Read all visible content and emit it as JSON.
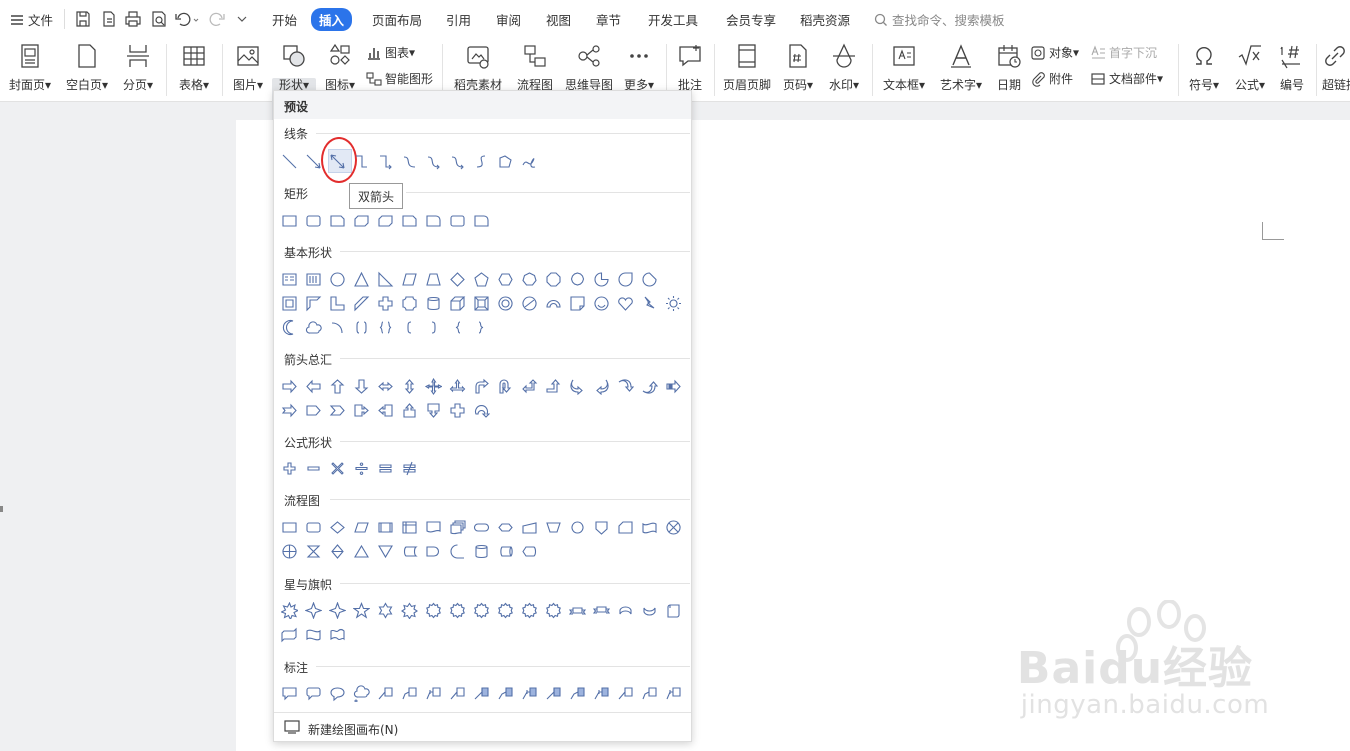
{
  "menubar": {
    "file": "文件",
    "tabs": [
      "开始",
      "插入",
      "页面布局",
      "引用",
      "审阅",
      "视图",
      "章节",
      "开发工具",
      "会员专享",
      "稻壳资源"
    ],
    "active_tab": "插入",
    "search_placeholder": "查找命令、搜索模板"
  },
  "ribbon": {
    "cover": "封面页",
    "blank": "空白页",
    "break": "分页",
    "table": "表格",
    "picture": "图片",
    "shape": "形状",
    "iconlib": "图标",
    "chart": "图表",
    "smartart": "智能图形",
    "material": "稻壳素材",
    "flowchart": "流程图",
    "mindmap": "思维导图",
    "more": "更多",
    "comment": "批注",
    "headerfooter": "页眉页脚",
    "pagenum": "页码",
    "watermark": "水印",
    "textbox": "文本框",
    "wordart": "艺术字",
    "date": "日期",
    "object": "对象",
    "dropcap": "首字下沉",
    "attachment": "附件",
    "docpart": "文档部件",
    "symbol": "符号",
    "formula": "公式",
    "numbering": "编号",
    "hyperlink": "超链接"
  },
  "panel": {
    "title": "预设",
    "sections": {
      "lines": "线条",
      "rects": "矩形",
      "basic": "基本形状",
      "arrows": "箭头总汇",
      "formula": "公式形状",
      "flow": "流程图",
      "stars": "星与旗帜",
      "callouts": "标注"
    },
    "tooltip": "双箭头",
    "new_canvas": "新建绘图画布(N)"
  },
  "watermark": {
    "brand": "Baidu经验",
    "url": "jingyan.baidu.com"
  },
  "colors": {
    "accent": "#2b74ea",
    "shape_stroke": "#5470a8",
    "highlight": "#e22d2d"
  }
}
